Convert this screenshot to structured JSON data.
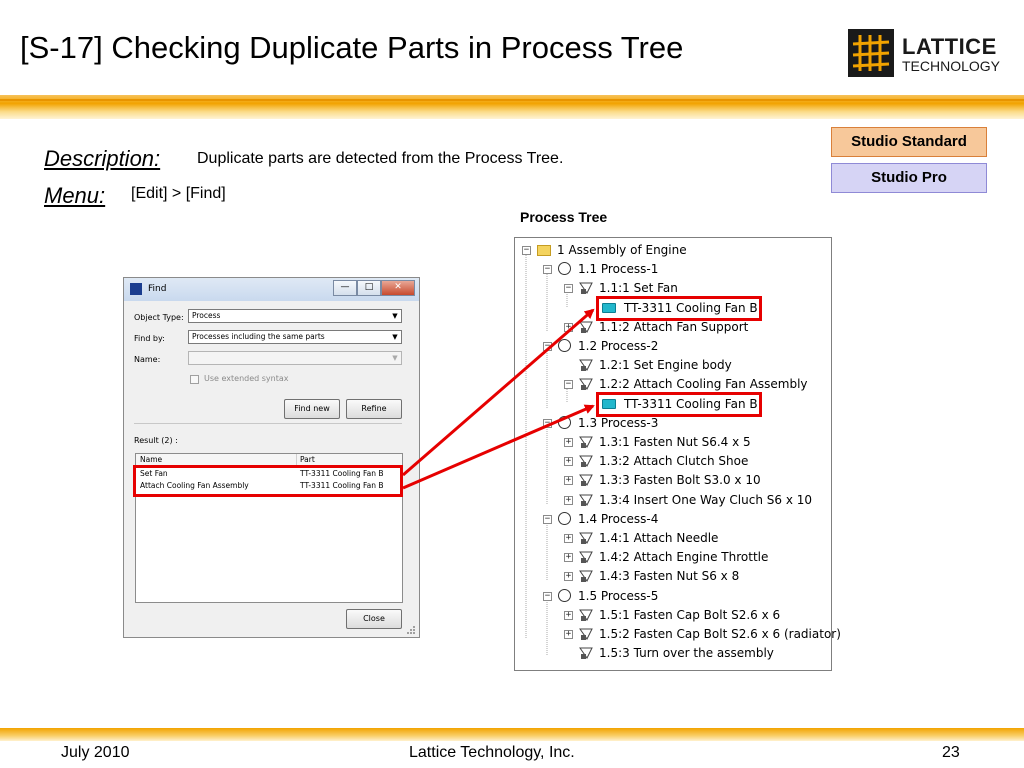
{
  "slide": {
    "title": "[S-17] Checking Duplicate Parts in Process Tree",
    "logo": {
      "word1": "LATTICE",
      "word2": "TECHNOLOGY"
    },
    "badges": {
      "standard": "Studio Standard",
      "pro": "Studio Pro"
    },
    "description_label": "Description:",
    "description_text": "Duplicate parts are detected from the Process Tree.",
    "menu_label": "Menu:",
    "menu_text": "[Edit] > [Find]",
    "tree_caption": "Process Tree"
  },
  "colors": {
    "accent_orange": "#f2a300",
    "highlight_red": "#e60000",
    "badge_standard": "#f7c89a",
    "badge_pro": "#d6d4f5",
    "part_cyan": "#22b7cc"
  },
  "find_dialog": {
    "title": "Find",
    "window_buttons": {
      "minimize": "—",
      "maximize": "□",
      "close": "✕"
    },
    "object_type_label": "Object Type:",
    "object_type_value": "Process",
    "find_by_label": "Find by:",
    "find_by_value": "Processes including the same parts",
    "name_label": "Name:",
    "name_value": "",
    "extended_syntax_label": "Use extended syntax",
    "find_new_label": "Find new",
    "refine_label": "Refine",
    "result_label": "Result (2) :",
    "columns": [
      "Name",
      "Part"
    ],
    "rows": [
      {
        "name": "Set Fan",
        "part": "TT-3311 Cooling Fan B"
      },
      {
        "name": "Attach Cooling Fan Assembly",
        "part": "TT-3311 Cooling Fan B"
      }
    ],
    "close_label": "Close"
  },
  "tree": {
    "icons": {
      "expand": "plus-box-icon",
      "collapse": "minus-box-icon",
      "assembly": "folder-icon",
      "process": "circle-icon",
      "operation": "operation-triangle-icon",
      "part": "part-icon"
    },
    "nodes": [
      {
        "label": "1 Assembly of Engine",
        "kind": "assembly",
        "toggle": "-"
      },
      {
        "label": "1.1 Process-1",
        "kind": "process",
        "toggle": "-"
      },
      {
        "label": "1.1:1 Set Fan",
        "kind": "op",
        "toggle": "-"
      },
      {
        "label": "TT-3311 Cooling Fan B",
        "kind": "part",
        "toggle": ""
      },
      {
        "label": "1.1:2 Attach Fan Support",
        "kind": "op",
        "toggle": "+"
      },
      {
        "label": "1.2 Process-2",
        "kind": "process",
        "toggle": "-"
      },
      {
        "label": "1.2:1 Set Engine body",
        "kind": "op",
        "toggle": ""
      },
      {
        "label": "1.2:2 Attach Cooling Fan Assembly",
        "kind": "op",
        "toggle": "-"
      },
      {
        "label": "TT-3311 Cooling Fan B",
        "kind": "part",
        "toggle": ""
      },
      {
        "label": "1.3 Process-3",
        "kind": "process",
        "toggle": "-"
      },
      {
        "label": "1.3:1 Fasten Nut S6.4 x 5",
        "kind": "op",
        "toggle": "+"
      },
      {
        "label": "1.3:2 Attach Clutch Shoe",
        "kind": "op",
        "toggle": "+"
      },
      {
        "label": "1.3:3 Fasten Bolt S3.0 x 10",
        "kind": "op",
        "toggle": "+"
      },
      {
        "label": "1.3:4 Insert One Way Cluch S6 x 10",
        "kind": "op",
        "toggle": "+"
      },
      {
        "label": "1.4 Process-4",
        "kind": "process",
        "toggle": "-"
      },
      {
        "label": "1.4:1 Attach Needle",
        "kind": "op",
        "toggle": "+"
      },
      {
        "label": "1.4:2 Attach Engine Throttle",
        "kind": "op",
        "toggle": "+"
      },
      {
        "label": "1.4:3 Fasten Nut S6 x 8",
        "kind": "op",
        "toggle": "+"
      },
      {
        "label": "1.5 Process-5",
        "kind": "process",
        "toggle": "-"
      },
      {
        "label": "1.5:1 Fasten Cap Bolt S2.6 x 6",
        "kind": "op",
        "toggle": "+"
      },
      {
        "label": "1.5:2 Fasten Cap Bolt S2.6 x 6 (radiator)",
        "kind": "op",
        "toggle": "+"
      },
      {
        "label": "1.5:3 Turn over the assembly",
        "kind": "op",
        "toggle": ""
      }
    ]
  },
  "footer": {
    "date": "July 2010",
    "company": "Lattice Technology, Inc.",
    "page": "23"
  }
}
